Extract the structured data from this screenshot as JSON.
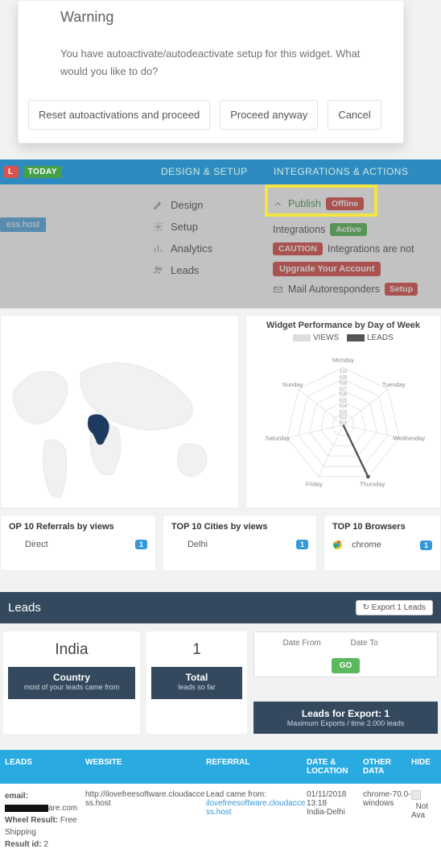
{
  "modal": {
    "title": "Warning",
    "message": "You have autoactivate/autodeactivate setup for this widget. What would you like to do?",
    "btn_reset": "Reset autoactivations and proceed",
    "btn_proceed": "Proceed anyway",
    "btn_cancel": "Cancel"
  },
  "header": {
    "today": "TODAY",
    "design_setup": "DESIGN & SETUP",
    "integrations": "INTEGRATIONS & ACTIONS",
    "ess_host": "ess.host"
  },
  "menu": {
    "design": "Design",
    "setup": "Setup",
    "analytics": "Analytics",
    "leads": "Leads"
  },
  "ia": {
    "publish": "Publish",
    "offline": "Offline",
    "integrations": "Integrations",
    "active": "Active",
    "caution": "CAUTION",
    "caution_msg": "Integrations are not",
    "upgrade": "Upgrade Your Account",
    "mail": "Mail Autoresponders",
    "setup": "Setup"
  },
  "chart": {
    "title": "Widget Performance by Day of Week",
    "legend_views": "VIEWS",
    "legend_leads": "LEADS"
  },
  "chart_data": {
    "type": "radar",
    "title": "Widget Performance by Day of Week",
    "categories": [
      "Monday",
      "Tuesday",
      "Wednesday",
      "Thursday",
      "Friday",
      "Saturday",
      "Sunday"
    ],
    "ticks": [
      0.1,
      0.2,
      0.3,
      0.4,
      0.5,
      0.6,
      0.7,
      0.8,
      0.9,
      1.0
    ],
    "series": [
      {
        "name": "VIEWS",
        "values": [
          0,
          0,
          0,
          0,
          0,
          0,
          0
        ]
      },
      {
        "name": "LEADS",
        "values": [
          0,
          0,
          0,
          1.0,
          0,
          0,
          0
        ]
      }
    ],
    "legend_position": "top"
  },
  "tops": {
    "referrals_title": "OP 10 Referrals by views",
    "referrals_item": "Direct",
    "referrals_count": "1",
    "cities_title": "TOP 10 Cities by views",
    "cities_item": "Delhi",
    "cities_count": "1",
    "browsers_title": "TOP 10 Browsers",
    "browsers_item": "chrome",
    "browsers_count": "1"
  },
  "leads": {
    "title": "Leads",
    "export_btn": "Export 1 Leads",
    "country_big": "India",
    "country_lbl": "Country",
    "country_sub": "most of your leads came from",
    "total_big": "1",
    "total_lbl": "Total",
    "total_sub": "leads so far",
    "date_from_ph": "Date From",
    "date_to_ph": "Date To",
    "go": "GO",
    "export_info_lbl": "Leads for Export: 1",
    "export_info_sub": "Maximum Exports / time 2.000 leads"
  },
  "table": {
    "h_leads": "LEADS",
    "h_website": "WEBSITE",
    "h_referral": "REFERRAL",
    "h_date": "DATE & LOCATION",
    "h_other": "OTHER DATA",
    "h_hide": "HIDE",
    "row": {
      "email_lbl": "email:",
      "domain_suffix": "are.com",
      "wheel_lbl": "Wheel Result:",
      "wheel_val": "Free Shipping",
      "result_lbl": "Result id:",
      "result_val": "2",
      "website": "http://ilovefreesoftware.cloudaccess.host",
      "ref_line1": "Lead came from:",
      "ref_link": "ilovefreesoftware.cloudaccess.host",
      "date": "01/11/2018",
      "time": "13:18",
      "loc": "India-Delhi",
      "browser": "chrome-70.0-windows",
      "avail": "Not Ava"
    }
  }
}
